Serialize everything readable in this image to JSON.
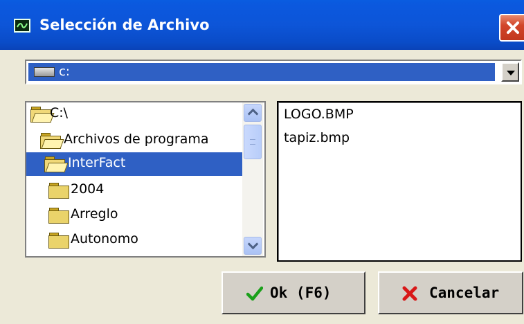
{
  "window": {
    "title": "Selección de Archivo"
  },
  "drive": {
    "selected": "c:"
  },
  "tree": {
    "items": [
      {
        "label": "C:\\",
        "open": true,
        "selected": false
      },
      {
        "label": "Archivos de programa",
        "open": true,
        "selected": false
      },
      {
        "label": "InterFact",
        "open": true,
        "selected": true
      },
      {
        "label": "2004",
        "open": false,
        "selected": false
      },
      {
        "label": "Arreglo",
        "open": false,
        "selected": false
      },
      {
        "label": "Autonomo",
        "open": false,
        "selected": false
      }
    ]
  },
  "files": {
    "items": [
      "LOGO.BMP",
      "tapiz.bmp"
    ]
  },
  "buttons": {
    "ok_label": "Ok (F6)",
    "cancel_label": "Cancelar"
  },
  "colors": {
    "titlebar": "#0b55d8",
    "selection": "#2f60c4",
    "face": "#ece9d8",
    "ok_icon": "#1aa01a",
    "cancel_icon": "#d81818"
  },
  "icons": {
    "title": "app-window-icon",
    "drive": "hard-drive-icon",
    "folder": "folder-icon",
    "ok": "checkmark-icon",
    "cancel": "x-mark-icon"
  }
}
